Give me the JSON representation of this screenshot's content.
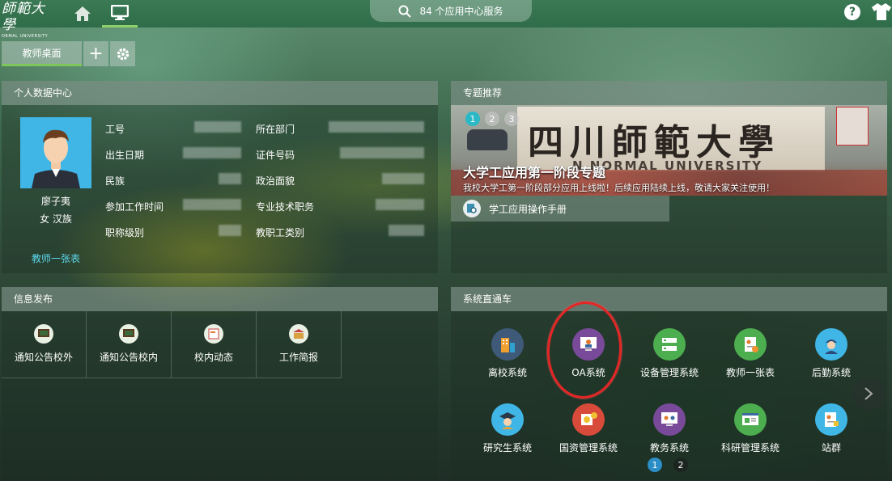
{
  "topbar": {
    "logo_cn": "師範大學",
    "logo_en": "ORMAL UNIVERSITY",
    "search_label": "84 个应用中心服务",
    "help_label": "?"
  },
  "tabs": {
    "desktop_label": "教师桌面",
    "add_label": "+"
  },
  "personal": {
    "title": "个人数据中心",
    "name": "廖子夷",
    "gender_ethnicity": "女 汉族",
    "card_link": "教师一张表",
    "left_fields": [
      "工号",
      "出生日期",
      "民族",
      "参加工作时间",
      "职称级别"
    ],
    "right_fields": [
      "所在部门",
      "证件号码",
      "政治面貌",
      "专业技术职务",
      "教职工类别"
    ]
  },
  "topic": {
    "title": "专题推荐",
    "pages": [
      "1",
      "2",
      "3"
    ],
    "banner_chars": "四川師範大學",
    "banner_en": "N NORMAL UNIVERSITY",
    "banner_title": "大学工应用第一阶段专题",
    "banner_desc": "我校大学工第一阶段部分应用上线啦！后续应用陆续上线，敬请大家关注使用！",
    "manual_label": "学工应用操作手册"
  },
  "info": {
    "title": "信息发布",
    "items": [
      "通知公告校外",
      "通知公告校内",
      "校内动态",
      "工作简报"
    ]
  },
  "systems": {
    "title": "系统直通车",
    "items": [
      {
        "label": "离校系统",
        "color": "#3e5a78"
      },
      {
        "label": "OA系统",
        "color": "#7a4a9a"
      },
      {
        "label": "设备管理系统",
        "color": "#4cae4f"
      },
      {
        "label": "教师一张表",
        "color": "#4cae4f"
      },
      {
        "label": "后勤系统",
        "color": "#3fb6e6"
      },
      {
        "label": "研究生系统",
        "color": "#3fb6e6"
      },
      {
        "label": "国资管理系统",
        "color": "#d84a3a"
      },
      {
        "label": "教务系统",
        "color": "#7a4a9a"
      },
      {
        "label": "科研管理系统",
        "color": "#4cae4f"
      },
      {
        "label": "站群",
        "color": "#3fb6e6"
      }
    ],
    "pages": [
      "1",
      "2"
    ]
  },
  "colors": {
    "accent_green": "#7fc65a",
    "link_cyan": "#5cd8ee",
    "highlight_red": "#e32626"
  }
}
